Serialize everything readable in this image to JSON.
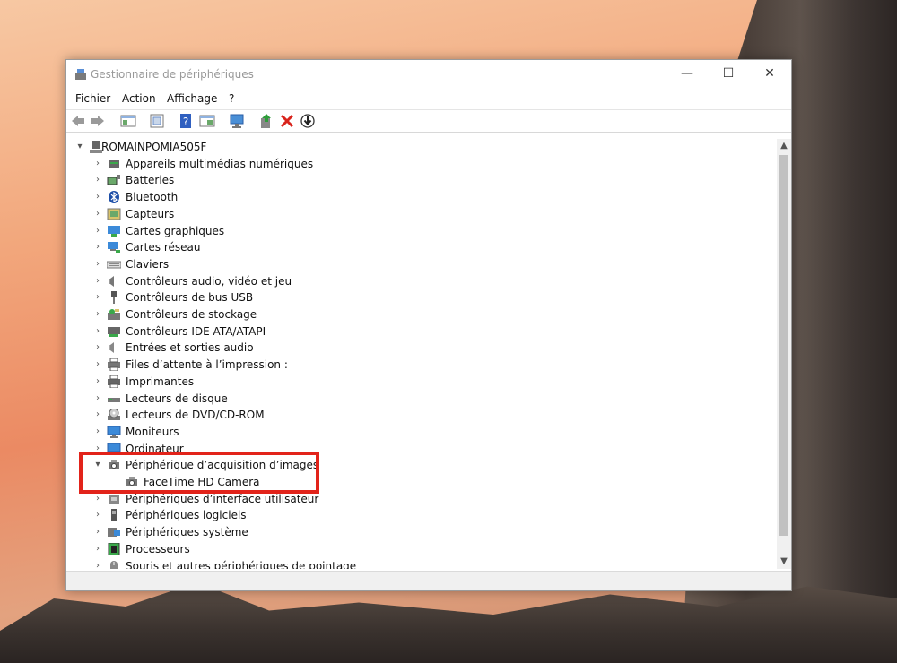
{
  "window": {
    "title": "Gestionnaire de périphériques",
    "controls": {
      "minimize": "—",
      "maximize": "☐",
      "close": "✕"
    }
  },
  "menu": [
    "Fichier",
    "Action",
    "Affichage",
    "?"
  ],
  "toolbar_icons": [
    "back-arrow-icon",
    "forward-arrow-icon",
    "show-hide-tree-icon",
    "properties-icon",
    "help-icon",
    "view-icon",
    "scan-hardware-icon",
    "update-driver-icon",
    "uninstall-icon",
    "download-driver-icon"
  ],
  "tree": {
    "root": "ROMAINPOMIA505F",
    "items": [
      {
        "label": "Appareils multimédias numériques",
        "icon": "media-device-icon",
        "expanded": false
      },
      {
        "label": "Batteries",
        "icon": "battery-icon",
        "expanded": false
      },
      {
        "label": "Bluetooth",
        "icon": "bluetooth-icon",
        "expanded": false
      },
      {
        "label": "Capteurs",
        "icon": "sensor-icon",
        "expanded": false
      },
      {
        "label": "Cartes graphiques",
        "icon": "display-adapter-icon",
        "expanded": false
      },
      {
        "label": "Cartes réseau",
        "icon": "network-adapter-icon",
        "expanded": false
      },
      {
        "label": "Claviers",
        "icon": "keyboard-icon",
        "expanded": false
      },
      {
        "label": "Contrôleurs audio, vidéo et jeu",
        "icon": "speaker-icon",
        "expanded": false
      },
      {
        "label": "Contrôleurs de bus USB",
        "icon": "usb-icon",
        "expanded": false
      },
      {
        "label": "Contrôleurs de stockage",
        "icon": "storage-controller-icon",
        "expanded": false
      },
      {
        "label": "Contrôleurs IDE ATA/ATAPI",
        "icon": "ide-controller-icon",
        "expanded": false
      },
      {
        "label": "Entrées et sorties audio",
        "icon": "audio-io-icon",
        "expanded": false
      },
      {
        "label": "Files d’attente à l’impression :",
        "icon": "print-queue-icon",
        "expanded": false
      },
      {
        "label": "Imprimantes",
        "icon": "printer-icon",
        "expanded": false
      },
      {
        "label": "Lecteurs de disque",
        "icon": "disk-drive-icon",
        "expanded": false
      },
      {
        "label": "Lecteurs de DVD/CD-ROM",
        "icon": "dvd-drive-icon",
        "expanded": false
      },
      {
        "label": "Moniteurs",
        "icon": "monitor-icon",
        "expanded": false
      },
      {
        "label": "Ordinateur",
        "icon": "computer-icon",
        "expanded": false
      },
      {
        "label": "Périphérique d’acquisition d’images",
        "icon": "camera-icon",
        "expanded": true,
        "children": [
          "FaceTime HD Camera"
        ]
      },
      {
        "label": "Périphériques d’interface utilisateur",
        "icon": "hid-icon",
        "expanded": false
      },
      {
        "label": "Périphériques logiciels",
        "icon": "software-device-icon",
        "expanded": false
      },
      {
        "label": "Périphériques système",
        "icon": "system-device-icon",
        "expanded": false
      },
      {
        "label": "Processeurs",
        "icon": "processor-icon",
        "expanded": false
      },
      {
        "label": "Souris et autres périphériques de pointage",
        "icon": "mouse-icon",
        "expanded": false
      }
    ]
  },
  "colors": {
    "highlight": "#e2231a",
    "accent": "#2b6cd4"
  }
}
